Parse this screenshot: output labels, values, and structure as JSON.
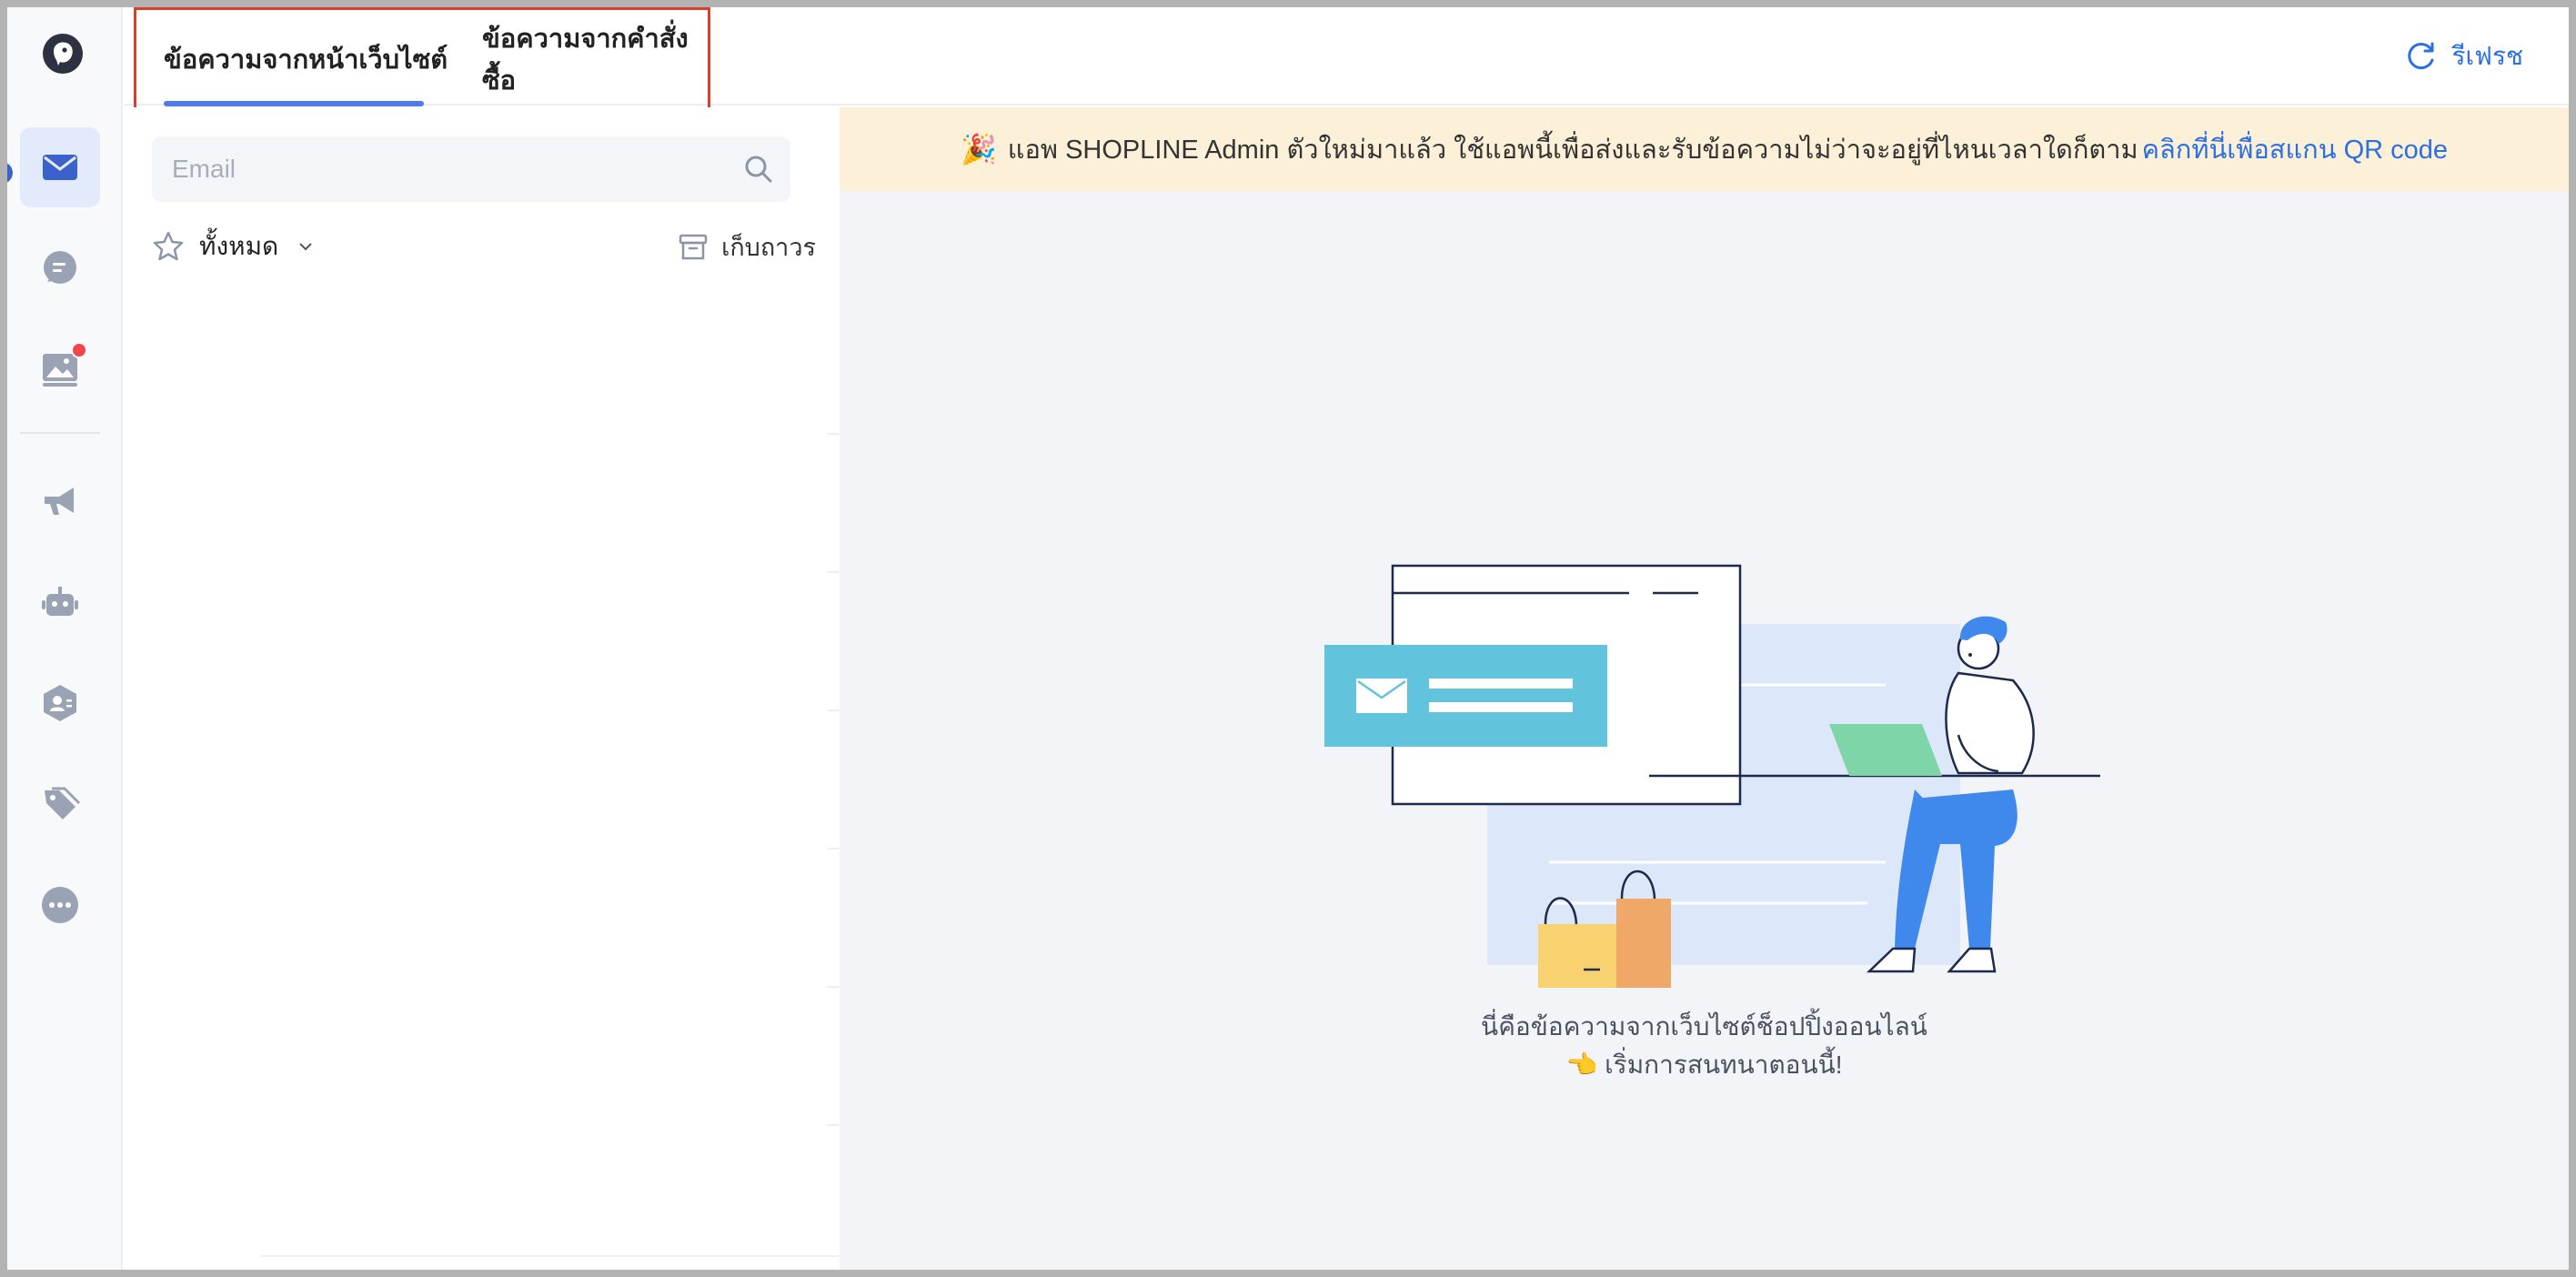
{
  "tabs": [
    {
      "label": "ข้อความจากหน้าเว็บไซต์",
      "active": true
    },
    {
      "label": "ข้อความจากคำสั่งซื้อ",
      "active": false
    }
  ],
  "refresh": {
    "label": "รีเฟรช",
    "icon": "refresh-icon"
  },
  "sidebar": {
    "logo": "shopline-bird-logo",
    "items": [
      {
        "icon": "mail-icon",
        "active": true
      },
      {
        "icon": "chat-icon"
      },
      {
        "icon": "image-message-icon",
        "badge": true
      },
      {
        "icon": "megaphone-icon"
      },
      {
        "icon": "bot-icon"
      },
      {
        "icon": "contact-shield-icon"
      },
      {
        "icon": "tag-icon"
      },
      {
        "icon": "more-icon"
      }
    ]
  },
  "search": {
    "placeholder": "Email"
  },
  "filter": {
    "label": "ทั้งหมด",
    "archive_label": "เก็บถาวร"
  },
  "banner": {
    "emoji": "🎉",
    "text": "แอพ SHOPLINE Admin ตัวใหม่มาแล้ว ใช้แอพนี้เพื่อส่งและรับข้อความไม่ว่าจะอยู่ที่ไหนเวลาใดก็ตาม",
    "link": "คลิกที่นี่เพื่อสแกน QR code"
  },
  "empty_state": {
    "line1": "นี่คือข้อความจากเว็บไซต์ช็อปปิ้งออนไลน์",
    "line2": "👈 เริ่มการสนทนาตอนนี้!"
  },
  "colors": {
    "accent": "#4a7cf0",
    "link": "#2b6fe2",
    "banner_bg": "#fcf0d8",
    "highlight_border": "#d9402b",
    "badge": "#f0474b"
  }
}
